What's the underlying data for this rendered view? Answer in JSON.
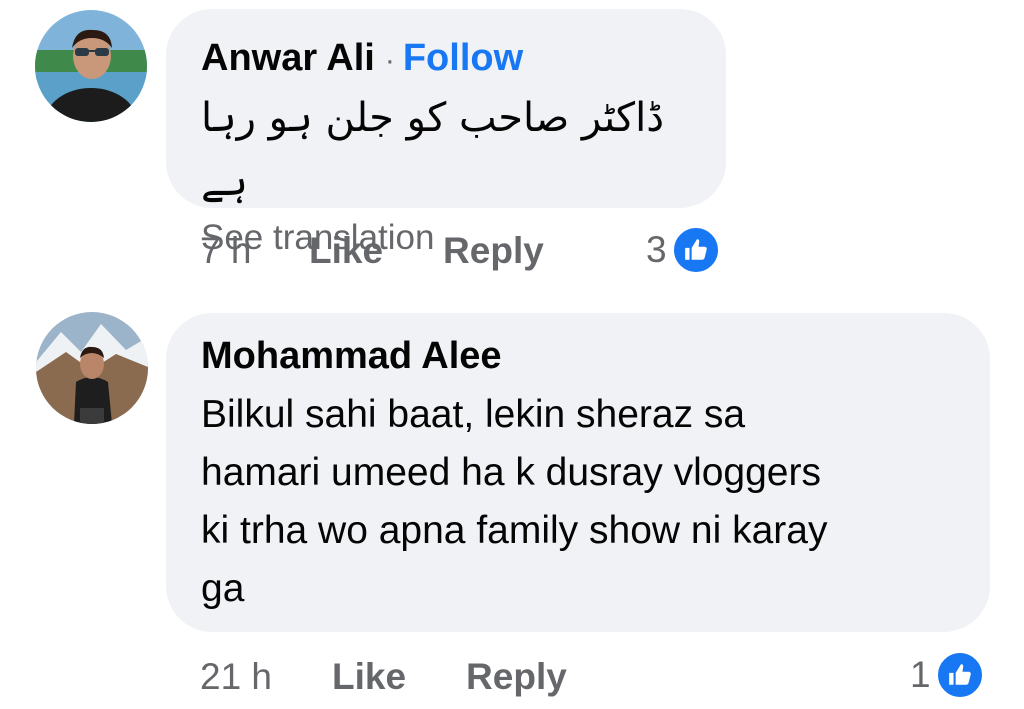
{
  "comments": [
    {
      "author": "Anwar Ali",
      "separator": "·",
      "follow_label": "Follow",
      "text": "ڈاکٹر صاحب  کو جلن ہو رہا ہے",
      "see_translation": "See translation",
      "time": "7 h",
      "like_label": "Like",
      "reply_label": "Reply",
      "reaction_count": "3",
      "reaction_icon": "like-thumb-icon",
      "accent_color": "#1877f2"
    },
    {
      "author": "Mohammad Alee",
      "text_lines": [
        "Bilkul sahi baat, lekin sheraz sa",
        "hamari umeed ha k dusray vloggers",
        "ki trha wo apna family show ni karay",
        "ga"
      ],
      "time": "21 h",
      "like_label": "Like",
      "reply_label": "Reply",
      "reaction_count": "1",
      "reaction_icon": "like-thumb-icon",
      "accent_color": "#1877f2"
    }
  ]
}
